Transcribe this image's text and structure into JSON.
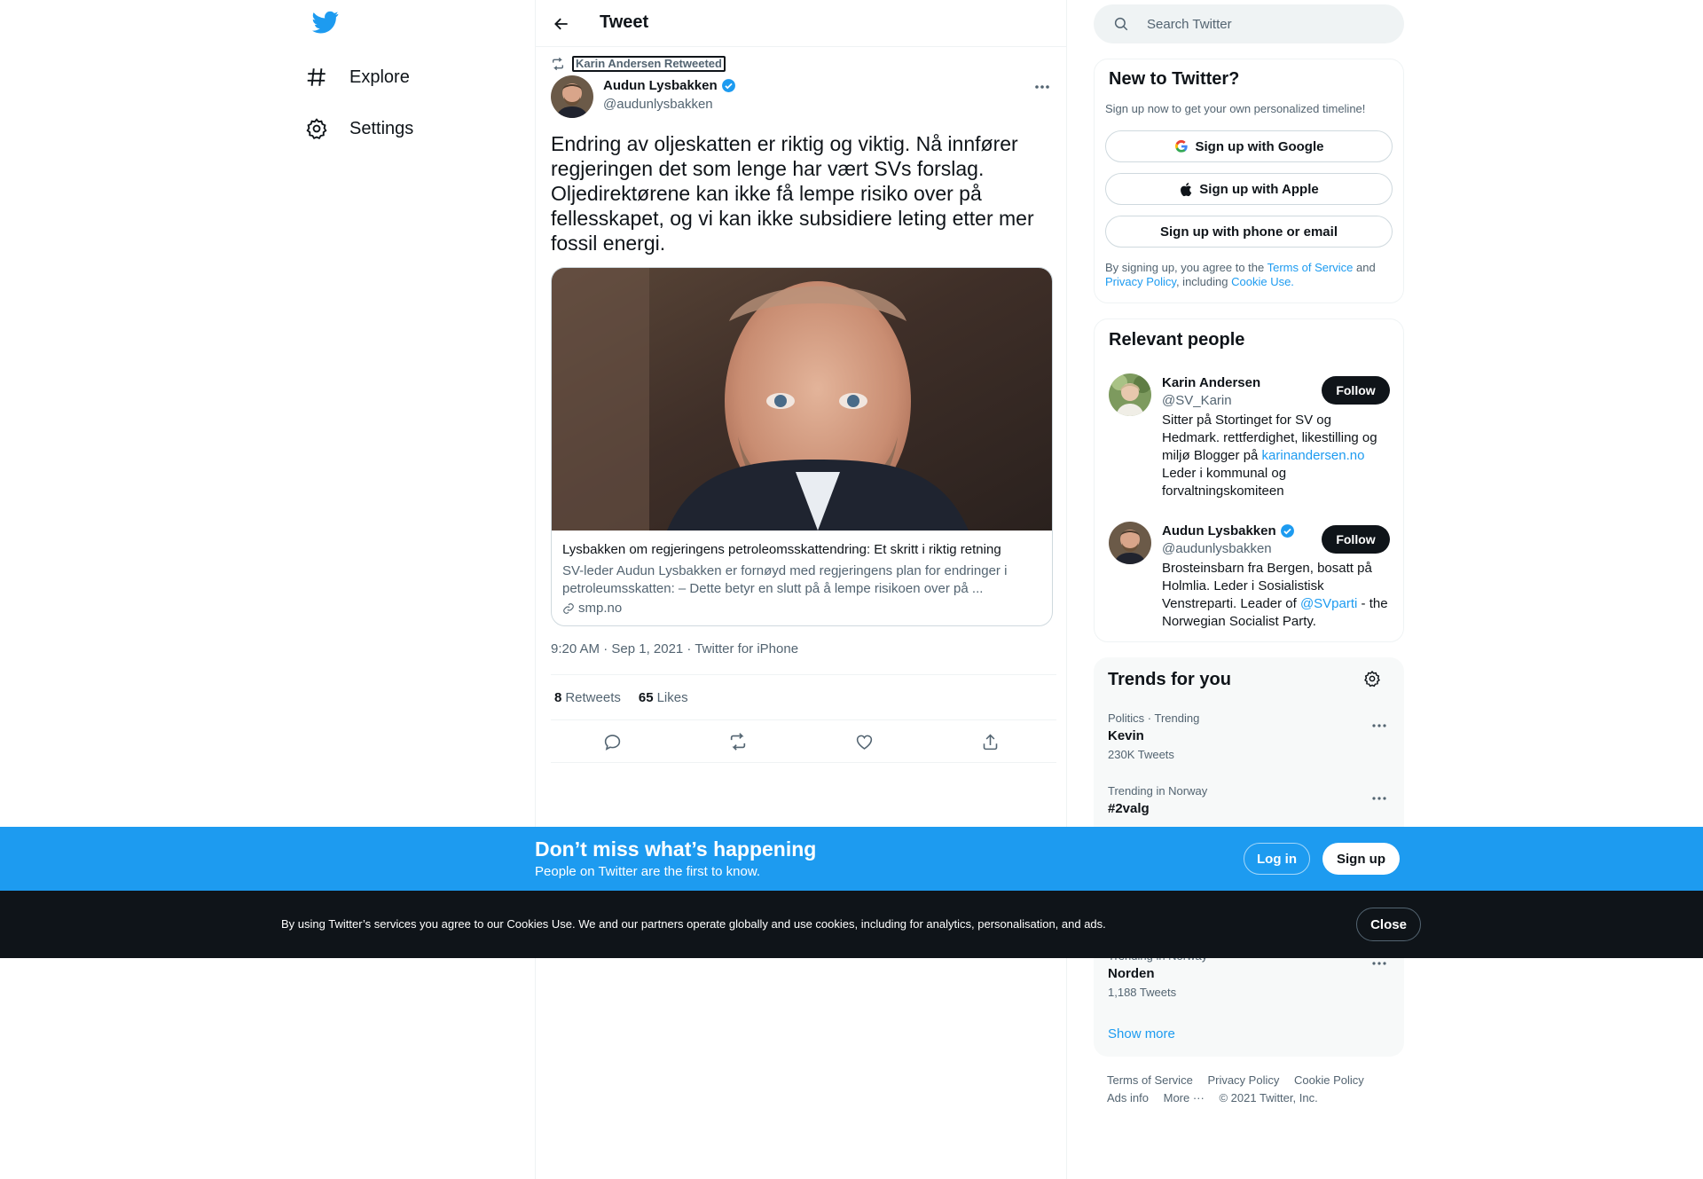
{
  "nav": {
    "items": [
      {
        "label": "Explore",
        "icon": "hashtag-icon"
      },
      {
        "label": "Settings",
        "icon": "gear-icon"
      }
    ]
  },
  "header": {
    "title": "Tweet"
  },
  "tweet": {
    "retweeted_by": "Karin Andersen Retweeted",
    "author_name": "Audun Lysbakken",
    "author_handle": "@audunlysbakken",
    "text": "Endring av oljeskatten er riktig og viktig. Nå innfører regjeringen det som lenge har vært SVs forslag. Oljedirektørene kan ikke få lempe risiko over på fellesskapet, og vi kan ikke subsidiere leting etter mer fossil energi.",
    "card": {
      "title": "Lysbakken om regjeringens petroleomsskattendring: Et skritt i riktig retning",
      "description": "SV-leder Audun Lysbakken er fornøyd med regjeringens plan for endringer i petroleumsskatten: – Dette betyr en slutt på å lempe risikoen over på ...",
      "domain": "smp.no"
    },
    "timestamp": "9:20 AM · Sep 1, 2021 · Twitter for iPhone",
    "retweets": "8",
    "retweets_label": "Retweets",
    "likes": "65",
    "likes_label": "Likes"
  },
  "search": {
    "placeholder": "Search Twitter"
  },
  "new_to_twitter": {
    "title": "New to Twitter?",
    "subtitle": "Sign up now to get your own personalized timeline!",
    "google_label": "Sign up with Google",
    "apple_label": "Sign up with Apple",
    "phone_label": "Sign up with phone or email",
    "legal_prefix": "By signing up, you agree to the ",
    "terms_link": "Terms of Service",
    "legal_and": " and ",
    "privacy_link": "Privacy Policy",
    "legal_including": ", including ",
    "cookie_link": "Cookie Use."
  },
  "relevant_people": {
    "title": "Relevant people",
    "people": [
      {
        "name": "Karin Andersen",
        "handle": "@SV_Karin",
        "bio_before": "Sitter på Stortinget for SV og Hedmark. rettferdighet, likestilling og miljø Blogger på ",
        "bio_link": "karinandersen.no",
        "bio_after": " Leder i kommunal og forvaltningskomiteen",
        "follow_label": "Follow"
      },
      {
        "name": "Audun Lysbakken",
        "handle": "@audunlysbakken",
        "bio_before": "Brosteinsbarn fra Bergen, bosatt på Holmlia. Leder i Sosialistisk Venstreparti. Leader of ",
        "bio_link": "@SVparti",
        "bio_after": " - the Norwegian Socialist Party.",
        "follow_label": "Follow"
      }
    ]
  },
  "trends": {
    "title": "Trends for you",
    "items": [
      {
        "meta": "Politics · Trending",
        "name": "Kevin",
        "count": "230K Tweets"
      },
      {
        "meta": "Trending in Norway",
        "name": "#2valg",
        "count": ""
      },
      {
        "meta": "Trending in Norway",
        "name": "Norden",
        "count": "1,188 Tweets"
      }
    ],
    "show_more": "Show more"
  },
  "footer": {
    "links": [
      "Terms of Service",
      "Privacy Policy",
      "Cookie Policy",
      "Ads info",
      "More ···",
      "© 2021 Twitter, Inc."
    ]
  },
  "signup_bar": {
    "title": "Don’t miss what’s happening",
    "subtitle": "People on Twitter are the first to know.",
    "login_label": "Log in",
    "signup_label": "Sign up"
  },
  "cookie_bar": {
    "text": "By using Twitter’s services you agree to our Cookies Use. We and our partners operate globally and use cookies, including for analytics, personalisation, and ads.",
    "close_label": "Close"
  },
  "colors": {
    "accent": "#1d9bf0",
    "text": "#0f1419",
    "muted": "#536471",
    "dark_bar": "#0f1419"
  }
}
